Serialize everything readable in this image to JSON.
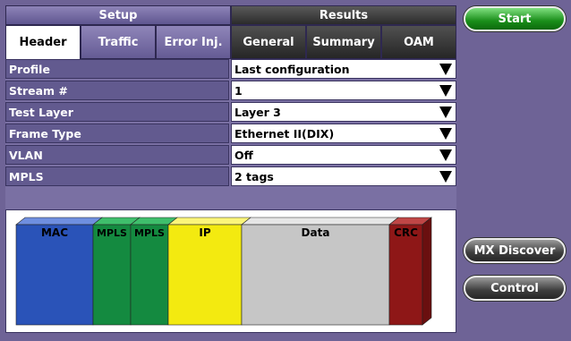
{
  "tabs": {
    "setup": "Setup",
    "results": "Results"
  },
  "subtabs": [
    {
      "label": "Header",
      "active": true
    },
    {
      "label": "Traffic",
      "active": false
    },
    {
      "label": "Error Inj.",
      "active": false
    },
    {
      "label": "General",
      "active": false
    },
    {
      "label": "Summary",
      "active": false
    },
    {
      "label": "OAM",
      "active": false
    }
  ],
  "fields": [
    {
      "label": "Profile",
      "value": "Last configuration"
    },
    {
      "label": "Stream #",
      "value": "1"
    },
    {
      "label": "Test Layer",
      "value": "Layer 3"
    },
    {
      "label": "Frame Type",
      "value": "Ethernet II(DIX)"
    },
    {
      "label": "VLAN",
      "value": "Off"
    },
    {
      "label": "MPLS",
      "value": "2 tags"
    }
  ],
  "frame_blocks": [
    {
      "label": "MAC",
      "color": "#2a53b8",
      "top_color": "#6f8fe0",
      "side_color": "#1d3d8a"
    },
    {
      "label": "MPLS",
      "color": "#148a40",
      "top_color": "#3fbf6c",
      "side_color": "#0d6a30"
    },
    {
      "label": "MPLS",
      "color": "#148a40",
      "top_color": "#3fbf6c",
      "side_color": "#0d6a30"
    },
    {
      "label": "IP",
      "color": "#f3ea10",
      "top_color": "#fbf57a",
      "side_color": "#c9c000"
    },
    {
      "label": "Data",
      "color": "#c6c6c6",
      "top_color": "#e6e6e6",
      "side_color": "#a6a6a6"
    },
    {
      "label": "CRC",
      "color": "#8e1717",
      "top_color": "#c04646",
      "side_color": "#6a0f0f"
    }
  ],
  "buttons": {
    "start": "Start",
    "mx_discover": "MX Discover",
    "control": "Control"
  }
}
